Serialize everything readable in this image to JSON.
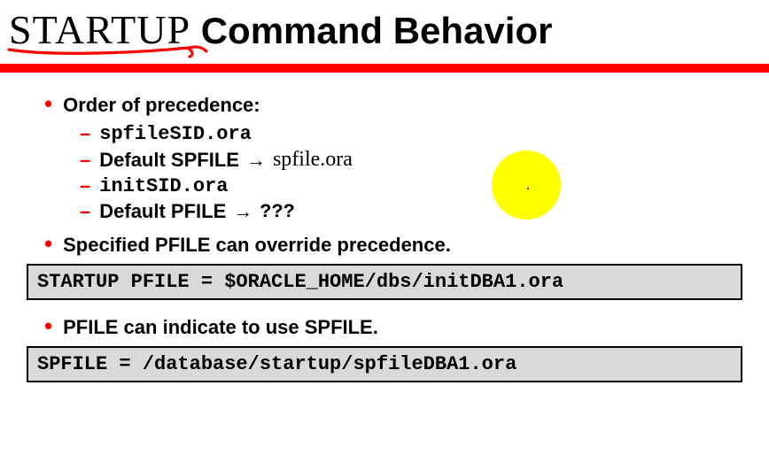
{
  "title": {
    "first_word": "STARTUP",
    "rest": " Command Behavior"
  },
  "bullets": {
    "order_heading": "Order of precedence:",
    "items": [
      {
        "text": "spfileSID.ora",
        "mono": true,
        "arrow": "",
        "note": ""
      },
      {
        "text": "Default SPFILE",
        "mono": false,
        "arrow": "→",
        "note": "spfile.ora"
      },
      {
        "text": "initSID.ora",
        "mono": true,
        "arrow": "",
        "note": ""
      },
      {
        "text": "Default PFILE",
        "mono": false,
        "arrow": "→",
        "note": "???"
      }
    ],
    "override_line": "Specified PFILE can override precedence.",
    "indicate_line": "PFILE can indicate to use SPFILE."
  },
  "codebox1": "STARTUP PFILE = $ORACLE_HOME/dbs/initDBA1.ora",
  "codebox2": "SPFILE = /database/startup/spfileDBA1.ora"
}
